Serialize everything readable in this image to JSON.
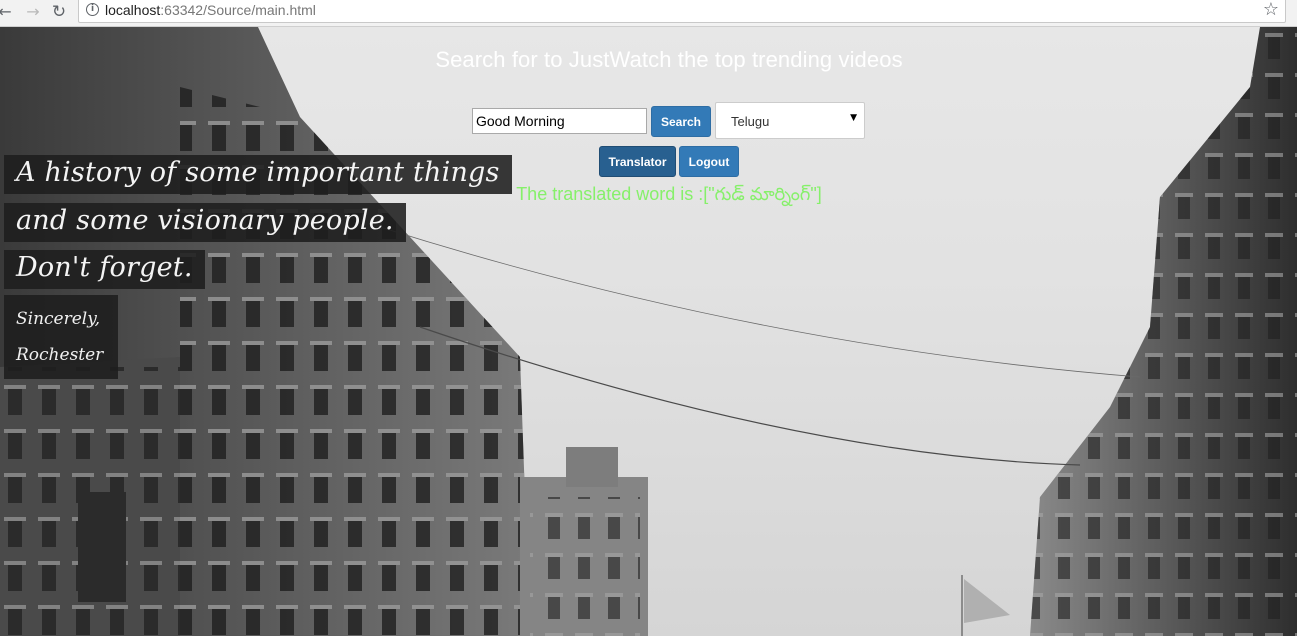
{
  "browser": {
    "url_host": "localhost",
    "url_rest": ":63342/Source/main.html"
  },
  "icons": {
    "back": "arrow-left-icon",
    "forward": "arrow-right-icon",
    "reload": "reload-icon",
    "info": "info-icon",
    "bookmark": "star-icon"
  },
  "background_quote": {
    "lines": [
      "A history of some important things",
      "and some visionary people.",
      "Don't forget."
    ],
    "signature": [
      "Sincerely,",
      "Rochester"
    ]
  },
  "app": {
    "heading": "Search for to JustWatch the top trending videos",
    "search": {
      "value": "Good Morning",
      "placeholder": ""
    },
    "search_button": "Search",
    "language_select": {
      "selected": "Telugu"
    },
    "translator_button": "Translator",
    "logout_button": "Logout",
    "result_text": "The translated word is :[\"గుడ్ మార్నింగ్\"]",
    "colors": {
      "button": "#337ab7",
      "button_active": "#286090",
      "heading": "#ffffff",
      "result": "#86f06a"
    }
  }
}
